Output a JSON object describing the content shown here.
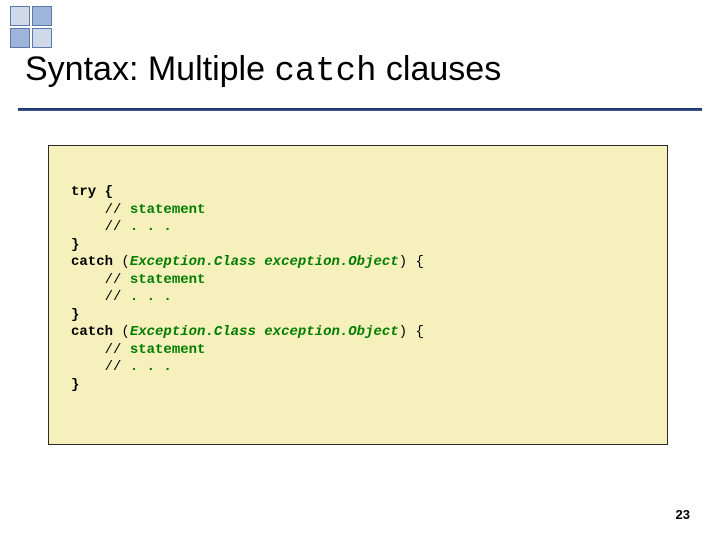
{
  "title": {
    "prefix": "Syntax: Multiple ",
    "mono": "catch",
    "suffix": " clauses"
  },
  "code": {
    "l1": "try {",
    "l2_indent": "    // ",
    "l2_text": "statement",
    "l3_indent": "    // ",
    "l3_text": ". . .",
    "l4": "}",
    "l5_kw": "catch ",
    "l5_paren_open": "(",
    "l5_class": "Exception.Class",
    "l5_space": " ",
    "l5_obj": "exception.Object",
    "l5_paren_close": ") {",
    "l6_indent": "    // ",
    "l6_text": "statement",
    "l7_indent": "    // ",
    "l7_text": ". . .",
    "l8": "}",
    "l9_kw": "catch ",
    "l9_paren_open": "(",
    "l9_class": "Exception.Class",
    "l9_space": " ",
    "l9_obj": "exception.Object",
    "l9_paren_close": ") {",
    "l10_indent": "    // ",
    "l10_text": "statement",
    "l11_indent": "    // ",
    "l11_text": ". . .",
    "l12": "}"
  },
  "page_number": "23"
}
